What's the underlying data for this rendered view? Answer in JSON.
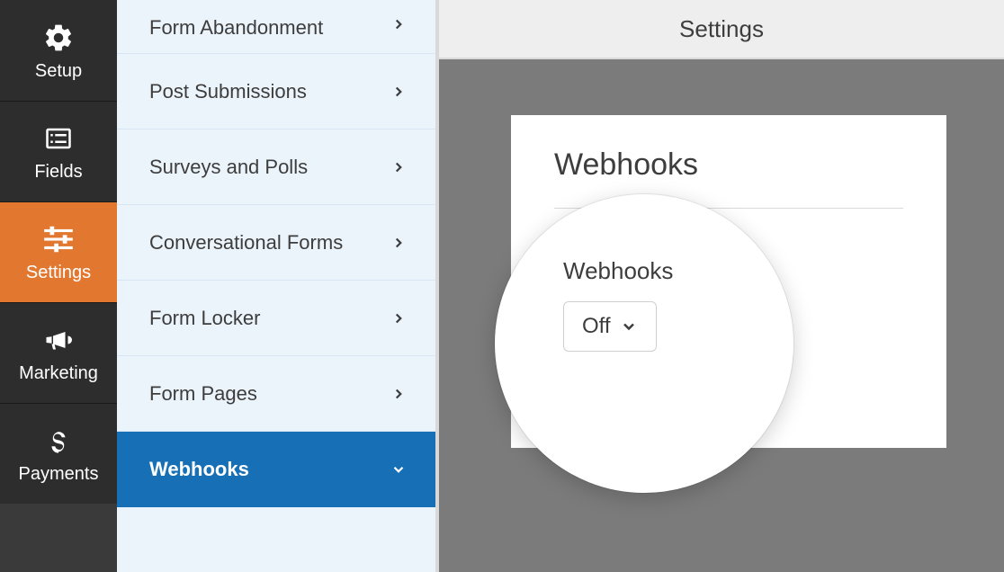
{
  "sidebar": {
    "items": [
      {
        "label": "Setup"
      },
      {
        "label": "Fields"
      },
      {
        "label": "Settings"
      },
      {
        "label": "Marketing"
      },
      {
        "label": "Payments"
      }
    ],
    "active_index": 2
  },
  "settings_list": {
    "items": [
      {
        "label": "Form Abandonment"
      },
      {
        "label": "Post Submissions"
      },
      {
        "label": "Surveys and Polls"
      },
      {
        "label": "Conversational Forms"
      },
      {
        "label": "Form Locker"
      },
      {
        "label": "Form Pages"
      },
      {
        "label": "Webhooks"
      }
    ],
    "selected_index": 6
  },
  "page": {
    "header": "Settings",
    "panel_title": "Webhooks",
    "zoom_label": "Webhooks",
    "dropdown_value": "Off"
  }
}
